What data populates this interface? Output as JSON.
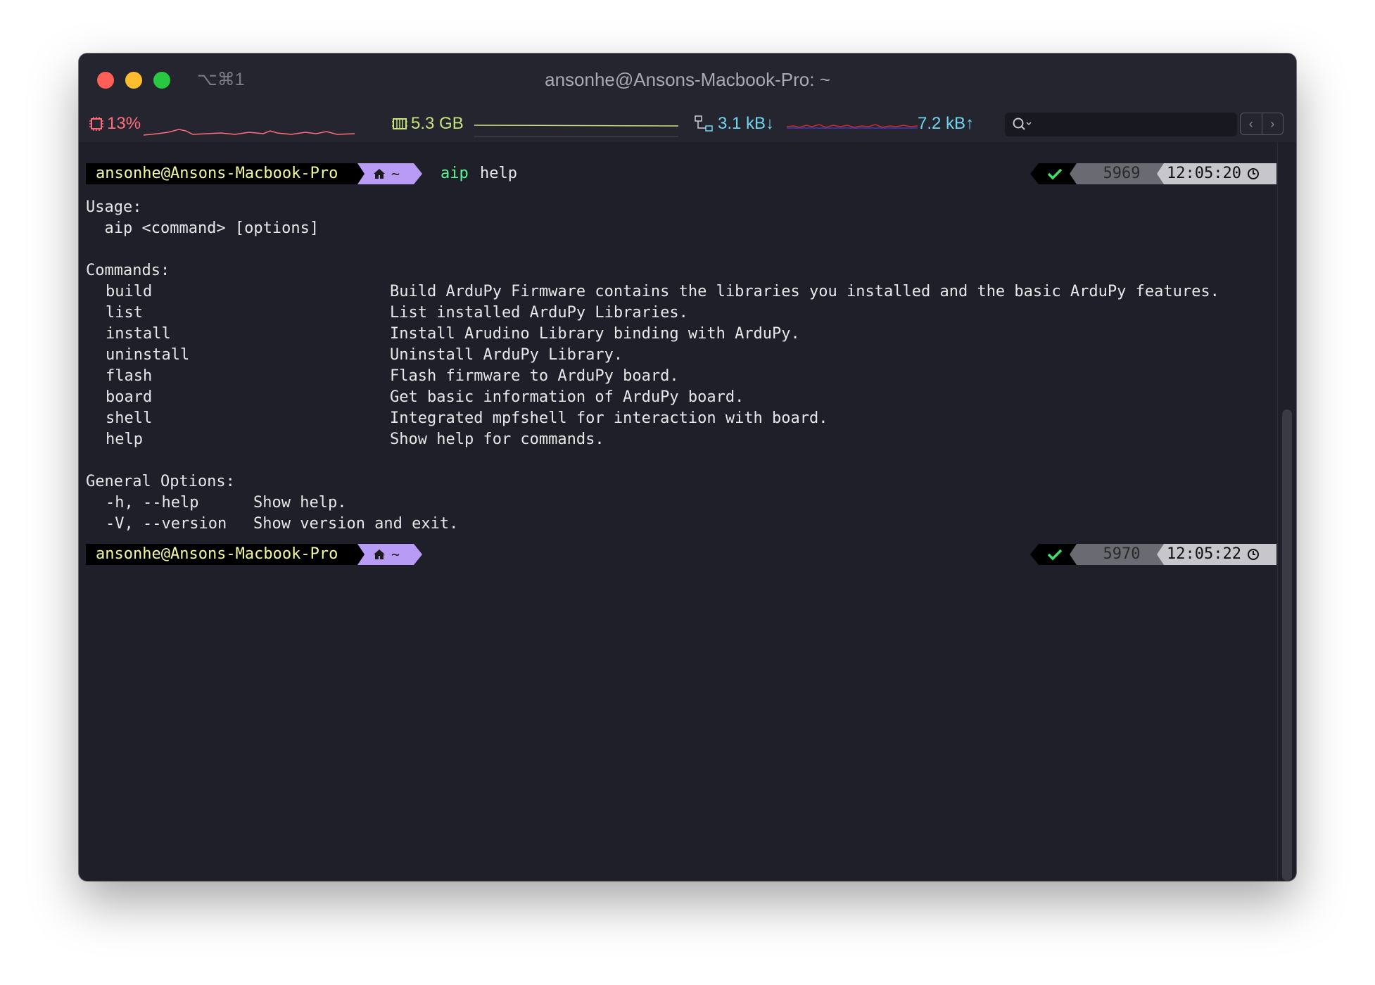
{
  "window": {
    "title": "ansonhe@Ansons-Macbook-Pro: ~",
    "shortcut": "⌥⌘1"
  },
  "statusbar": {
    "cpu": "13%",
    "memory": "5.3 GB",
    "net_down": "3.1 kB↓",
    "net_up": "7.2 kB↑",
    "colors": {
      "cpu": "#ff6c7a",
      "memory": "#c6e27a",
      "network": "#6fd6ee"
    },
    "icons": [
      "cpu-chip-icon",
      "memory-icon",
      "network-icon",
      "search-icon"
    ]
  },
  "nav": {
    "back": "‹",
    "forward": "›"
  },
  "prompt1": {
    "user": "ansonhe@Ansons-Macbook-Pro",
    "dir": "~",
    "command": "aip",
    "argument": "help",
    "history": "5969",
    "time": "12:05:20"
  },
  "output": {
    "usage_header": "Usage:",
    "usage_line": "  aip <command> [options]",
    "commands_header": "Commands:",
    "commands": [
      {
        "name": "build",
        "desc": "Build ArduPy Firmware contains the libraries you installed and the basic ArduPy features."
      },
      {
        "name": "list",
        "desc": "List installed ArduPy Libraries."
      },
      {
        "name": "install",
        "desc": "Install Arudino Library binding with ArduPy."
      },
      {
        "name": "uninstall",
        "desc": "Uninstall ArduPy Library."
      },
      {
        "name": "flash",
        "desc": "Flash firmware to ArduPy board."
      },
      {
        "name": "board",
        "desc": "Get basic information of ArduPy board."
      },
      {
        "name": "shell",
        "desc": "Integrated mpfshell for interaction with board."
      },
      {
        "name": "help",
        "desc": "Show help for commands."
      }
    ],
    "options_header": "General Options:",
    "options": [
      {
        "name": "-h, --help",
        "desc": "Show help."
      },
      {
        "name": "-V, --version",
        "desc": "Show version and exit."
      }
    ]
  },
  "prompt2": {
    "user": "ansonhe@Ansons-Macbook-Pro",
    "dir": "~",
    "history": "5970",
    "time": "12:05:22"
  }
}
